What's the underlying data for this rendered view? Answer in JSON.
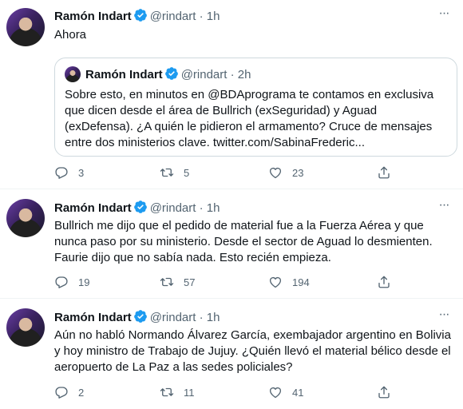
{
  "tweets": [
    {
      "name": "Ramón Indart",
      "handle": "@rindart",
      "dot": "·",
      "time": "1h",
      "text": "Ahora",
      "quote": {
        "name": "Ramón Indart",
        "handle": "@rindart",
        "dot": "·",
        "time": "2h",
        "text": "Sobre esto, en minutos en @BDAprograma te contamos en exclusiva que dicen desde el área de Bullrich (exSeguridad) y Aguad (exDefensa). ¿A quién le pidieron el armamento? Cruce de mensajes entre dos ministerios clave. twitter.com/SabinaFrederic..."
      },
      "replies": "3",
      "retweets": "5",
      "likes": "23"
    },
    {
      "name": "Ramón Indart",
      "handle": "@rindart",
      "dot": "·",
      "time": "1h",
      "text": "Bullrich me dijo que el pedido de material fue a la Fuerza Aérea y que nunca paso por su ministerio. Desde el sector de Aguad lo desmienten. Faurie dijo que no sabía nada. Esto recién empieza.",
      "replies": "19",
      "retweets": "57",
      "likes": "194"
    },
    {
      "name": "Ramón Indart",
      "handle": "@rindart",
      "dot": "·",
      "time": "1h",
      "text": "Aún no habló Normando Álvarez García, exembajador argentino en Bolivia y hoy ministro de Trabajo de Jujuy. ¿Quién llevó el material bélico desde el aeropuerto de La Paz a las sedes policiales?",
      "replies": "2",
      "retweets": "11",
      "likes": "41"
    }
  ],
  "colors": {
    "verified": "#1d9bf0",
    "muted": "#536471",
    "border": "#cfd9de"
  }
}
